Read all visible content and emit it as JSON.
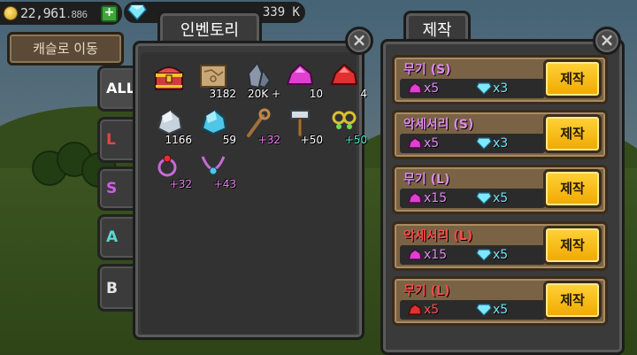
{
  "top_bar": {
    "gold_main": "22,961",
    "gold_sub": "886",
    "plus_label": "+",
    "gems": "339 K"
  },
  "move_castle_label": "캐슬로 이동",
  "tabs": [
    {
      "label": "ALL",
      "color": "#ffffff"
    },
    {
      "label": "L",
      "color": "#e14646"
    },
    {
      "label": "S",
      "color": "#d35cf0"
    },
    {
      "label": "A",
      "color": "#59d8d2"
    },
    {
      "label": "B",
      "color": "#e6e6e6"
    }
  ],
  "inventory": {
    "title": "인벤토리",
    "close_label": "×",
    "items": [
      {
        "icon": "treasure-chest-icon",
        "qty": ""
      },
      {
        "icon": "map-scroll-icon",
        "qty": "3182"
      },
      {
        "icon": "iron-ore-icon",
        "qty": "20K +"
      },
      {
        "icon": "pink-gem-icon",
        "qty": "10"
      },
      {
        "icon": "red-gem-icon",
        "qty": "4"
      },
      {
        "icon": "silver-ore-icon",
        "qty": "1166"
      },
      {
        "icon": "blue-crystal-icon",
        "qty": "59"
      },
      {
        "icon": "wooden-staff-icon",
        "qty": "+32"
      },
      {
        "icon": "hammer-icon",
        "qty": "+50"
      },
      {
        "icon": "earrings-icon",
        "qty": "+50"
      },
      {
        "icon": "ring-icon",
        "qty": "+32"
      },
      {
        "icon": "necklace-icon",
        "qty": "+43"
      }
    ]
  },
  "crafting": {
    "title": "제작",
    "close_label": "×",
    "recipes": [
      {
        "name": "무기 (S)",
        "gem_color": "pink",
        "gem_qty": "x5",
        "diamond_qty": "x3",
        "button": "제작"
      },
      {
        "name": "악세서리 (S)",
        "gem_color": "pink",
        "gem_qty": "x5",
        "diamond_qty": "x3",
        "button": "제작"
      },
      {
        "name": "무기 (L)",
        "gem_color": "pink",
        "gem_qty": "x15",
        "diamond_qty": "x5",
        "button": "제작"
      },
      {
        "name": "악세서리 (L)",
        "gem_color": "pink",
        "gem_qty": "x15",
        "diamond_qty": "x5",
        "button": "제작"
      },
      {
        "name": "무기 (L)",
        "gem_color": "red",
        "gem_qty": "x5",
        "diamond_qty": "x5",
        "button": "제작"
      }
    ]
  },
  "colors": {
    "panel": "#3a3a3a",
    "craft_button": "#f0a800",
    "pink_gem": "#e040d0",
    "red_gem": "#e03030",
    "diamond": "#6fe3f5"
  }
}
